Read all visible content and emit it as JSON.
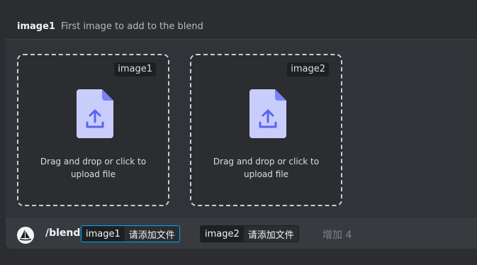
{
  "option": {
    "name": "image1",
    "description": "First image to add to the blend"
  },
  "dropzones": [
    {
      "tag": "image1",
      "text": "Drag and drop or click to\nupload file",
      "icon": "file-upload-icon"
    },
    {
      "tag": "image2",
      "text": "Drag and drop or click to\nupload file",
      "icon": "file-upload-icon"
    }
  ],
  "command_bar": {
    "bot_icon": "midjourney-sailboat-icon",
    "command": "/blend",
    "options": [
      {
        "name": "image1",
        "value": "请添加文件",
        "active": true
      },
      {
        "name": "image2",
        "value": "请添加文件",
        "active": false
      }
    ],
    "more_label": "增加 4"
  },
  "colors": {
    "accent": "#00a8fc",
    "file_icon": "#c9cdfb",
    "upload_arrow": "#5865f2"
  }
}
